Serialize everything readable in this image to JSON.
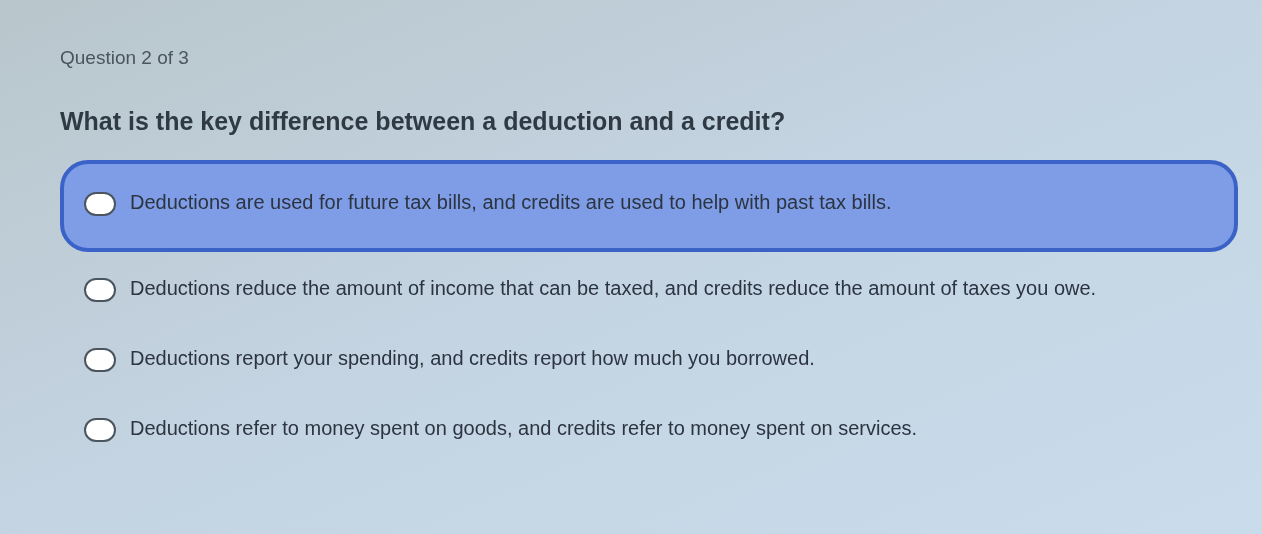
{
  "progress": "Question 2 of 3",
  "question": "What is the key difference between a deduction and a credit?",
  "options": [
    {
      "label": "Deductions are used for future tax bills, and credits are used to help with past tax bills.",
      "selected": true
    },
    {
      "label": "Deductions reduce the amount of income that can be taxed, and credits reduce the amount of taxes you owe.",
      "selected": false
    },
    {
      "label": "Deductions report your spending, and credits report how much you borrowed.",
      "selected": false
    },
    {
      "label": "Deductions refer to money spent on goods, and credits refer to money spent on services.",
      "selected": false
    }
  ]
}
